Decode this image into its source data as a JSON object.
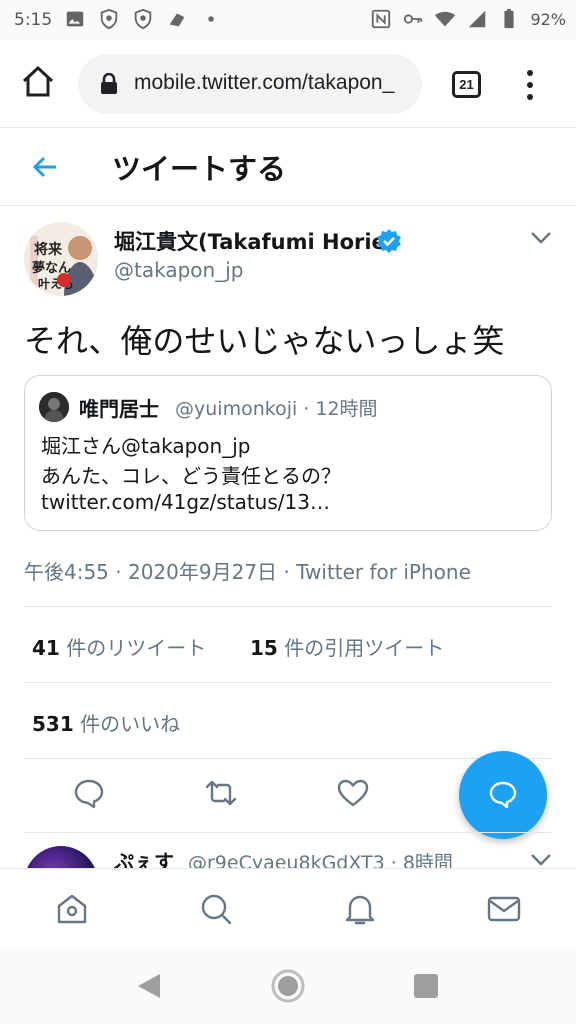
{
  "status_bar": {
    "time": "5:15",
    "battery": "92%",
    "icons": [
      "image-icon",
      "vpn-shield-icon",
      "vpn-shield-icon",
      "game-icon",
      "dot-icon",
      "nfc-icon",
      "key-icon",
      "wifi-icon",
      "signal-icon",
      "battery-icon"
    ]
  },
  "browser": {
    "url": "mobile.twitter.com/takapon_",
    "tab_count": "21"
  },
  "header": {
    "title": "ツイートする"
  },
  "tweet": {
    "author_name": "堀江貴文(Takafumi Horie)",
    "handle": "@takapon_jp",
    "verified": true,
    "text": "それ、俺のせいじゃないっしょ笑",
    "timestamp": "午後4:55 · 2020年9月27日 · Twitter for iPhone",
    "quote": {
      "name": "唯門居士",
      "meta": "@yuimonkoji · 12時間",
      "lines": [
        "堀江さん@takapon_jp",
        "あんた、コレ、どう責任とるの？",
        "twitter.com/41gz/status/13…"
      ]
    },
    "retweets_count": "41",
    "retweets_label": " 件のリツイート",
    "quotes_count": "15",
    "quotes_label": " 件の引用ツイート",
    "likes_count": "531",
    "likes_label": " 件のいいね"
  },
  "reply": {
    "name": "ぷぇす",
    "meta": "@r9eCyaeu8kGdXT3 · 8時間"
  },
  "colors": {
    "accent": "#1da1f2",
    "text": "#14171a",
    "secondary": "#657786",
    "border": "#e1e8ed"
  }
}
